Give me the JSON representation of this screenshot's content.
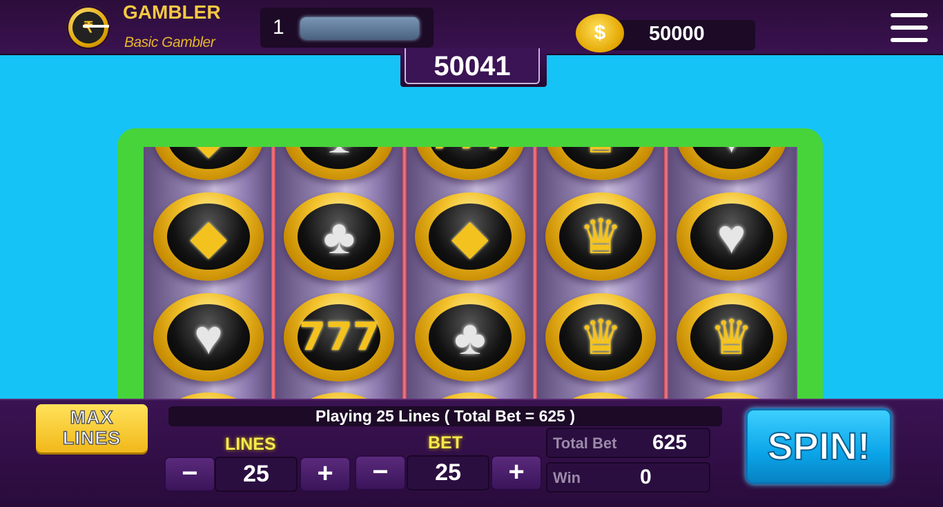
{
  "header": {
    "brand_title": "GAMBLER",
    "brand_subtitle": "Basic Gambler",
    "level": "1",
    "xp_progress": 0,
    "coins": "50000",
    "coin_symbol": "$"
  },
  "jackpot": "50041",
  "reels": [
    [
      "diamond",
      "diamond",
      "heart"
    ],
    [
      "club",
      "club",
      "seven"
    ],
    [
      "seven",
      "diamond",
      "club"
    ],
    [
      "crown",
      "crown",
      "crown"
    ],
    [
      "heart",
      "heart",
      "crown"
    ]
  ],
  "controls": {
    "max_lines_line1": "MAX",
    "max_lines_line2": "LINES",
    "status": "Playing 25 Lines ( Total Bet = 625 )",
    "lines_label": "LINES",
    "lines_value": "25",
    "bet_label": "BET",
    "bet_value": "25",
    "minus": "−",
    "plus": "+",
    "total_bet_label": "Total Bet",
    "total_bet_value": "625",
    "win_label": "Win",
    "win_value": "0",
    "spin_label": "SPIN!"
  },
  "colors": {
    "background": "#16c3f6",
    "frame": "#47d43a",
    "bar": "#3a1352",
    "gold": "#f4c21e",
    "spin": "#0aa4e8"
  }
}
